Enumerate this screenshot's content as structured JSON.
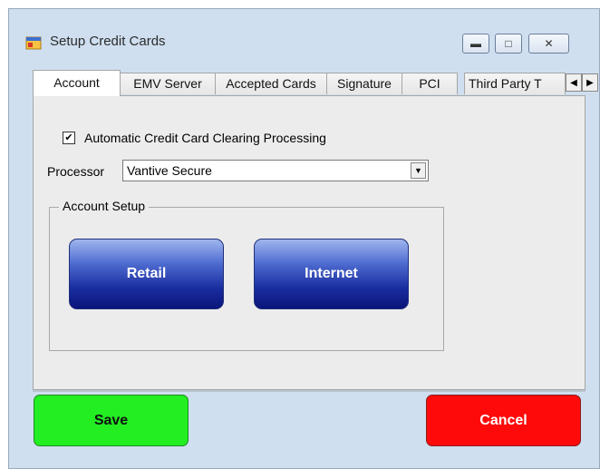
{
  "window": {
    "title": "Setup Credit Cards",
    "controls": {
      "minimize": "minimize",
      "maximize": "maximize",
      "close": "close"
    }
  },
  "tabs": [
    {
      "label": "Account",
      "selected": true
    },
    {
      "label": "EMV Server",
      "selected": false
    },
    {
      "label": "Accepted Cards",
      "selected": false
    },
    {
      "label": "Signature",
      "selected": false
    },
    {
      "label": "PCI",
      "selected": false
    },
    {
      "label": "Third Party T",
      "selected": false
    }
  ],
  "account": {
    "auto_clearing_label": "Automatic Credit Card Clearing Processing",
    "auto_clearing_checked": true,
    "processor_label": "Processor",
    "processor_value": "Vantive Secure",
    "group_title": "Account Setup",
    "retail_label": "Retail",
    "internet_label": "Internet"
  },
  "footer": {
    "save_label": "Save",
    "cancel_label": "Cancel"
  },
  "colors": {
    "save": "#22ee22",
    "cancel": "#ff0a0a",
    "setup_button": "#1a2ea0"
  }
}
